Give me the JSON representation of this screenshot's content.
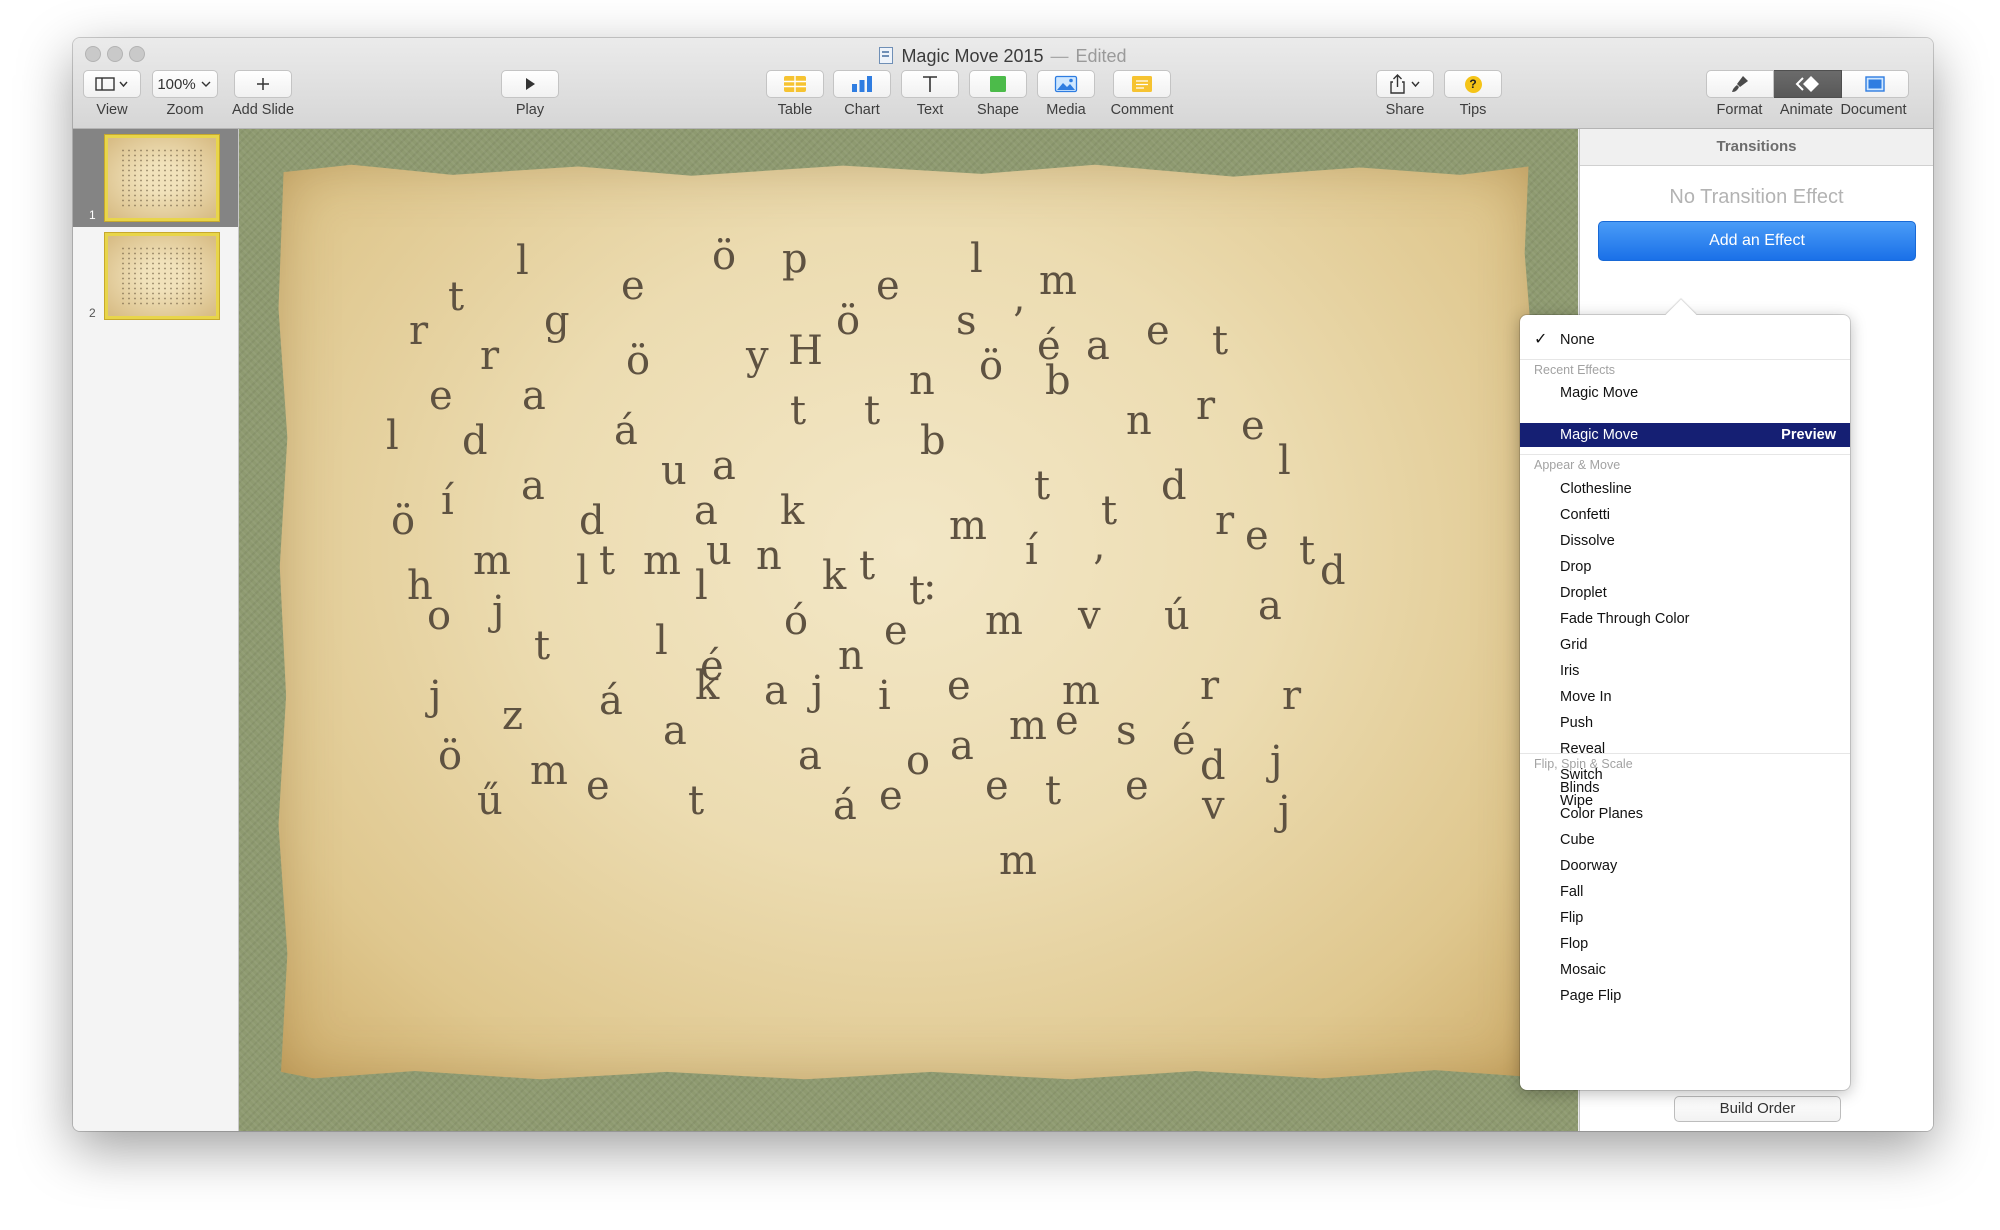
{
  "window": {
    "title": "Magic Move 2015",
    "status": "Edited"
  },
  "toolbar": {
    "view_label": "View",
    "zoom_value": "100%",
    "zoom_label": "Zoom",
    "add_slide_label": "Add Slide",
    "play_label": "Play",
    "table_label": "Table",
    "chart_label": "Chart",
    "text_label": "Text",
    "shape_label": "Shape",
    "media_label": "Media",
    "comment_label": "Comment",
    "share_label": "Share",
    "tips_label": "Tips",
    "tips_glyph": "?",
    "format_label": "Format",
    "animate_label": "Animate",
    "document_label": "Document"
  },
  "navigator": {
    "slides": [
      {
        "number": "1",
        "selected": true
      },
      {
        "number": "2",
        "selected": false
      }
    ]
  },
  "slide": {
    "letters": [
      "l",
      "e",
      "ö",
      "p",
      "e",
      "l",
      "m",
      "t",
      "g",
      "ö",
      "s",
      "r",
      "r",
      "ö",
      "y",
      "H",
      "’",
      "é",
      "a",
      "e",
      "t",
      "n",
      "ö",
      "b",
      "e",
      "a",
      "t",
      "t",
      "n",
      "r",
      "e",
      "l",
      "d",
      "á",
      "b",
      "u",
      "a",
      "a",
      "t",
      "d",
      "l",
      "í",
      "ö",
      "d",
      "a",
      "k",
      "m",
      "t",
      "r",
      "e",
      "m",
      "l",
      "m",
      "u",
      "n",
      "í",
      "t",
      "h",
      "t",
      "l",
      "k",
      "t",
      "’",
      "d",
      "t",
      ":",
      "o",
      "j",
      "ó",
      "e",
      "m",
      "v",
      "ú",
      "a",
      "t",
      "l",
      "é",
      "n",
      "j",
      "k",
      "a",
      "j",
      "i",
      "e",
      "m",
      "r",
      "r",
      "z",
      "á",
      "a",
      "e",
      "s",
      "é",
      "ö",
      "a",
      "o",
      "a",
      "m",
      "d",
      "j",
      "m",
      "e",
      "t",
      "á",
      "e",
      "e",
      "t",
      "e",
      "ű",
      "v",
      "j",
      "m"
    ]
  },
  "inspector": {
    "header": "Transitions",
    "no_effect": "No Transition Effect",
    "add_effect": "Add an Effect",
    "build_order": "Build Order"
  },
  "effects_menu": {
    "none": "None",
    "recent_header": "Recent Effects",
    "recent": [
      "Magic Move"
    ],
    "highlighted": "Magic Move",
    "preview": "Preview",
    "appear_header": "Appear & Move",
    "appear": [
      "Clothesline",
      "Confetti",
      "Dissolve",
      "Drop",
      "Droplet",
      "Fade Through Color",
      "Grid",
      "Iris",
      "Move In",
      "Push",
      "Reveal",
      "Switch",
      "Wipe"
    ],
    "flip_header": "Flip, Spin & Scale",
    "flip": [
      "Blinds",
      "Color Planes",
      "Cube",
      "Doorway",
      "Fall",
      "Flip",
      "Flop",
      "Mosaic",
      "Page Flip"
    ]
  },
  "colors": {
    "accent_blue": "#1a70e8",
    "menu_highlight": "#151f73",
    "thumbnail_border": "#e8d54a",
    "canvas_green": "#8e9a70"
  }
}
